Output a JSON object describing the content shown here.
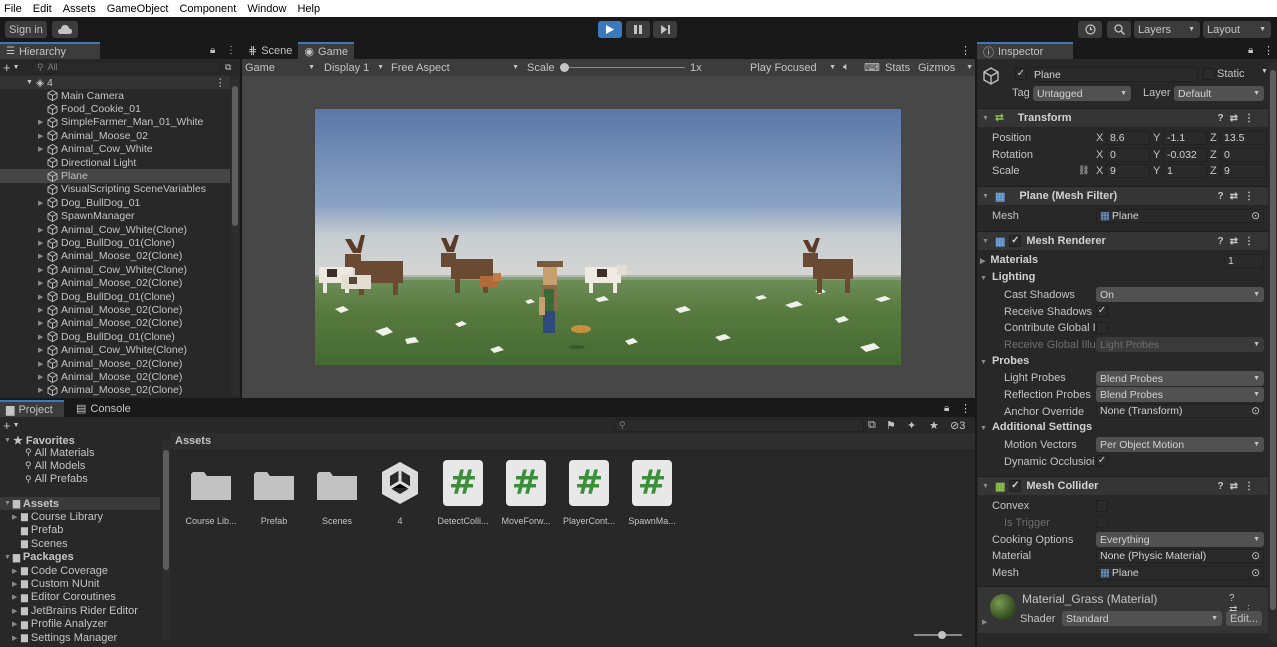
{
  "menu": [
    "File",
    "Edit",
    "Assets",
    "GameObject",
    "Component",
    "Window",
    "Help"
  ],
  "toolbar": {
    "sign_in": "Sign in",
    "layers": "Layers",
    "layout": "Layout"
  },
  "hierarchy": {
    "tab": "Hierarchy",
    "search_placeholder": "All",
    "scene": "4",
    "items": [
      {
        "label": "Main Camera",
        "expand": false
      },
      {
        "label": "Food_Cookie_01",
        "expand": false
      },
      {
        "label": "SimpleFarmer_Man_01_White",
        "expand": true
      },
      {
        "label": "Animal_Moose_02",
        "expand": true
      },
      {
        "label": "Animal_Cow_White",
        "expand": true
      },
      {
        "label": "Directional Light",
        "expand": false
      },
      {
        "label": "Plane",
        "expand": false,
        "selected": true
      },
      {
        "label": "VisualScripting SceneVariables",
        "expand": false
      },
      {
        "label": "Dog_BullDog_01",
        "expand": true
      },
      {
        "label": "SpawnManager",
        "expand": false
      },
      {
        "label": "Animal_Cow_White(Clone)",
        "expand": true
      },
      {
        "label": "Dog_BullDog_01(Clone)",
        "expand": true
      },
      {
        "label": "Animal_Moose_02(Clone)",
        "expand": true
      },
      {
        "label": "Animal_Cow_White(Clone)",
        "expand": true
      },
      {
        "label": "Animal_Moose_02(Clone)",
        "expand": true
      },
      {
        "label": "Dog_BullDog_01(Clone)",
        "expand": true
      },
      {
        "label": "Animal_Moose_02(Clone)",
        "expand": true
      },
      {
        "label": "Animal_Moose_02(Clone)",
        "expand": true
      },
      {
        "label": "Dog_BullDog_01(Clone)",
        "expand": true
      },
      {
        "label": "Animal_Cow_White(Clone)",
        "expand": true
      },
      {
        "label": "Animal_Moose_02(Clone)",
        "expand": true
      },
      {
        "label": "Animal_Moose_02(Clone)",
        "expand": true
      },
      {
        "label": "Animal_Moose_02(Clone)",
        "expand": true
      }
    ]
  },
  "game_view": {
    "tabs": [
      "Scene",
      "Game"
    ],
    "display_mode": "Game",
    "display": "Display 1",
    "aspect": "Free Aspect",
    "scale_label": "Scale",
    "scale_value": "1x",
    "play_mode": "Play Focused",
    "stats": "Stats",
    "gizmos": "Gizmos"
  },
  "project": {
    "tabs": [
      "Project",
      "Console"
    ],
    "hidden_count": "3",
    "breadcrumb": "Assets",
    "favorites_label": "Favorites",
    "favorites": [
      "All Materials",
      "All Models",
      "All Prefabs"
    ],
    "assets_label": "Assets",
    "assets_tree": [
      "Course Library",
      "Prefab",
      "Scenes"
    ],
    "packages_label": "Packages",
    "packages": [
      "Code Coverage",
      "Custom NUnit",
      "Editor Coroutines",
      "JetBrains Rider Editor",
      "Profile Analyzer",
      "Settings Manager"
    ],
    "grid": [
      {
        "label": "Course Lib...",
        "kind": "folder"
      },
      {
        "label": "Prefab",
        "kind": "folder"
      },
      {
        "label": "Scenes",
        "kind": "folder"
      },
      {
        "label": "4",
        "kind": "unity"
      },
      {
        "label": "DetectColli...",
        "kind": "script"
      },
      {
        "label": "MoveForw...",
        "kind": "script"
      },
      {
        "label": "PlayerCont...",
        "kind": "script"
      },
      {
        "label": "SpawnMa...",
        "kind": "script"
      }
    ],
    "script_glyph": "#"
  },
  "inspector": {
    "tab": "Inspector",
    "name": "Plane",
    "static_label": "Static",
    "tag_label": "Tag",
    "tag": "Untagged",
    "layer_label": "Layer",
    "layer": "Default",
    "transform": {
      "title": "Transform",
      "position_label": "Position",
      "px": "8.6",
      "py": "-1.1",
      "pz": "13.5",
      "rotation_label": "Rotation",
      "rx": "0",
      "ry": "-0.032",
      "rz": "0",
      "scale_label": "Scale",
      "sx": "9",
      "sy": "1",
      "sz": "9",
      "x": "X",
      "y": "Y",
      "z": "Z"
    },
    "mesh_filter": {
      "title": "Plane (Mesh Filter)",
      "mesh_label": "Mesh",
      "mesh": "Plane"
    },
    "mesh_renderer": {
      "title": "Mesh Renderer",
      "materials_label": "Materials",
      "materials_count": "1",
      "lighting_label": "Lighting",
      "cast_shadows_label": "Cast Shadows",
      "cast_shadows": "On",
      "receive_shadows_label": "Receive Shadows",
      "contribute_gi_label": "Contribute Global I",
      "receive_gi_label": "Receive Global Illu",
      "receive_gi": "Light Probes",
      "probes_label": "Probes",
      "light_probes_label": "Light Probes",
      "light_probes": "Blend Probes",
      "reflection_probes_label": "Reflection Probes",
      "reflection_probes": "Blend Probes",
      "anchor_override_label": "Anchor Override",
      "anchor_override": "None (Transform)",
      "additional_label": "Additional Settings",
      "motion_vectors_label": "Motion Vectors",
      "motion_vectors": "Per Object Motion",
      "dynamic_occlusion_label": "Dynamic Occlusioi"
    },
    "mesh_collider": {
      "title": "Mesh Collider",
      "convex_label": "Convex",
      "is_trigger_label": "Is Trigger",
      "cooking_label": "Cooking Options",
      "cooking": "Everything",
      "material_label": "Material",
      "material": "None (Physic Material)",
      "mesh_label": "Mesh",
      "mesh": "Plane"
    },
    "material": {
      "title": "Material_Grass (Material)",
      "shader_label": "Shader",
      "shader": "Standard",
      "edit": "Edit..."
    }
  },
  "colors": {
    "accent": "#3a79bb",
    "panel": "#282828",
    "header": "#191919",
    "selection": "#464646",
    "script_green": "#3b8f3b"
  }
}
